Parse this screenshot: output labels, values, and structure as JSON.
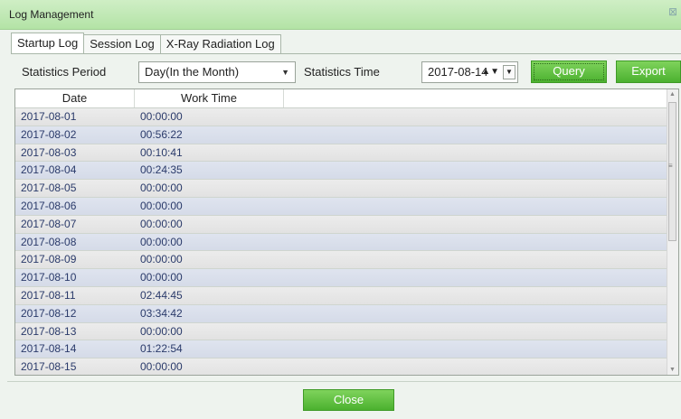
{
  "window": {
    "title": "Log Management",
    "close_glyph": "⊠"
  },
  "tabs": [
    {
      "label": "Startup Log",
      "active": true
    },
    {
      "label": "Session Log",
      "active": false
    },
    {
      "label": "X-Ray Radiation Log",
      "active": false
    }
  ],
  "filters": {
    "period_label": "Statistics Period",
    "period_value": "Day(In the Month)",
    "time_label": "Statistics Time",
    "time_value": "2017-08-14",
    "query_label": "Query",
    "export_label": "Export"
  },
  "table": {
    "columns": [
      "Date",
      "Work Time"
    ],
    "rows": [
      [
        "2017-08-01",
        "00:00:00"
      ],
      [
        "2017-08-02",
        "00:56:22"
      ],
      [
        "2017-08-03",
        "00:10:41"
      ],
      [
        "2017-08-04",
        "00:24:35"
      ],
      [
        "2017-08-05",
        "00:00:00"
      ],
      [
        "2017-08-06",
        "00:00:00"
      ],
      [
        "2017-08-07",
        "00:00:00"
      ],
      [
        "2017-08-08",
        "00:00:00"
      ],
      [
        "2017-08-09",
        "00:00:00"
      ],
      [
        "2017-08-10",
        "00:00:00"
      ],
      [
        "2017-08-11",
        "02:44:45"
      ],
      [
        "2017-08-12",
        "03:34:42"
      ],
      [
        "2017-08-13",
        "00:00:00"
      ],
      [
        "2017-08-14",
        "01:22:54"
      ],
      [
        "2017-08-15",
        "00:00:00"
      ]
    ]
  },
  "footer": {
    "close_label": "Close"
  },
  "colors": {
    "accent_green": "#4bb12f",
    "title_green": "#b3e3a6",
    "row_blue": "#d5dbe8"
  }
}
